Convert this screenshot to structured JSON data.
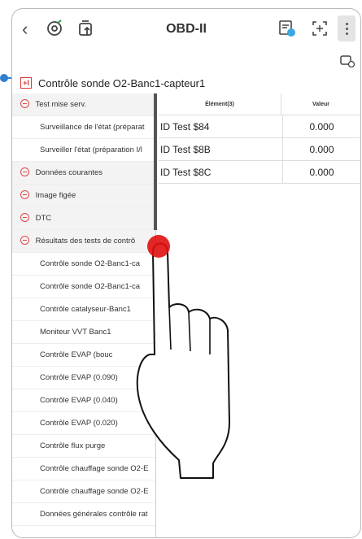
{
  "header": {
    "back_icon": "chevron-left-icon",
    "title": "OBD-II"
  },
  "section": {
    "title": "Contrôle sonde O2-Banc1-capteur1"
  },
  "sidebar": {
    "groups": [
      {
        "label": "Test mise serv.",
        "items": [
          {
            "label": "Surveillance de l'état (préparat"
          },
          {
            "label": "Surveiller l'état (préparation I/l"
          }
        ]
      },
      {
        "label": "Données courantes",
        "items": []
      },
      {
        "label": "Image figée",
        "items": []
      },
      {
        "label": "DTC",
        "items": []
      },
      {
        "label": "Résultats des tests de contrô",
        "items": [
          {
            "label": "Contrôle sonde O2-Banc1-ca"
          },
          {
            "label": "Contrôle sonde O2-Banc1-ca"
          },
          {
            "label": "Contrôle catalyseur-Banc1"
          },
          {
            "label": "Moniteur VVT Banc1"
          },
          {
            "label": "Contrôle EVAP (bouc"
          },
          {
            "label": "Contrôle EVAP (0.090)"
          },
          {
            "label": "Contrôle EVAP (0.040)"
          },
          {
            "label": "Contrôle EVAP (0.020)"
          },
          {
            "label": "Contrôle flux purge"
          },
          {
            "label": "Contrôle chauffage sonde O2-E"
          },
          {
            "label": "Contrôle chauffage sonde O2-E"
          },
          {
            "label": "Données générales contrôle rat"
          }
        ]
      }
    ]
  },
  "table": {
    "headers": [
      "Élément(3)",
      "Valeur"
    ],
    "rows": [
      [
        "ID Test $84",
        "0.000"
      ],
      [
        "ID Test $8B",
        "0.000"
      ],
      [
        "ID Test $8C",
        "0.000"
      ]
    ]
  },
  "colors": {
    "accent_red": "#e04848",
    "callout_blue": "#2f7fd2",
    "touch_red": "#e01010"
  }
}
